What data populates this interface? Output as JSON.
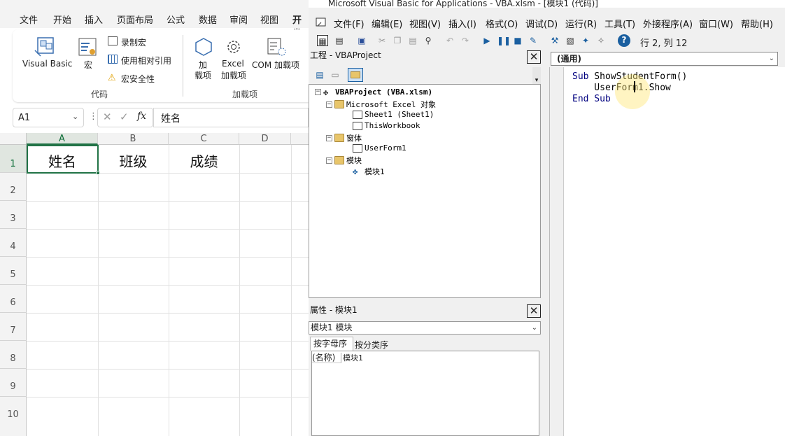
{
  "excel": {
    "ribbon_tabs": [
      "文件",
      "开始",
      "插入",
      "页面布局",
      "公式",
      "数据",
      "审阅",
      "视图",
      "开发"
    ],
    "ribbon": {
      "visual_basic": "Visual Basic",
      "macros": "宏",
      "record_macro": "录制宏",
      "relative_ref": "使用相对引用",
      "macro_security": "宏安全性",
      "group_code": "代码",
      "addins": "加\n载项",
      "addins_line1": "加",
      "addins_line2": "载项",
      "excel_addins_line1": "Excel",
      "excel_addins_line2": "加载项",
      "com_addins": "COM 加载项",
      "group_addins": "加载项"
    },
    "name_box": "A1",
    "formula_value": "姓名",
    "fx": "fx",
    "columns": [
      "A",
      "B",
      "C",
      "D"
    ],
    "rows": [
      "1",
      "2",
      "3",
      "4",
      "5",
      "6",
      "7",
      "8",
      "9",
      "10"
    ],
    "cells": {
      "A1": "姓名",
      "B1": "班级",
      "C1": "成绩"
    }
  },
  "vbe": {
    "title": "Microsoft Visual Basic for Applications - VBA.xlsm - [模块1 (代码)]",
    "menu": [
      "文件(F)",
      "编辑(E)",
      "视图(V)",
      "插入(I)",
      "格式(O)",
      "调试(D)",
      "运行(R)",
      "工具(T)",
      "外接程序(A)",
      "窗口(W)",
      "帮助(H)"
    ],
    "cursor_pos": "行 2, 列 12",
    "project_title": "工程 - VBAProject",
    "tree": {
      "root": "VBAProject (VBA.xlsm)",
      "excel_objects": "Microsoft Excel 对象",
      "sheet1": "Sheet1 (Sheet1)",
      "workbook": "ThisWorkbook",
      "forms": "窗体",
      "userform1": "UserForm1",
      "modules": "模块",
      "module1": "模块1"
    },
    "props_title": "属性 - 模块1",
    "props_object": "模块1 模块",
    "props_tab_alpha": "按字母序",
    "props_tab_cat": "按分类序",
    "props_name_key": "(名称)",
    "props_name_val": "模块1",
    "code_scope": "(通用)",
    "code": {
      "line1_kw": "Sub",
      "line1_rest": " ShowStudentForm()",
      "line2": "    UserForm1.Show",
      "line3_kw": "End Sub"
    },
    "close_glyph": "✕"
  }
}
